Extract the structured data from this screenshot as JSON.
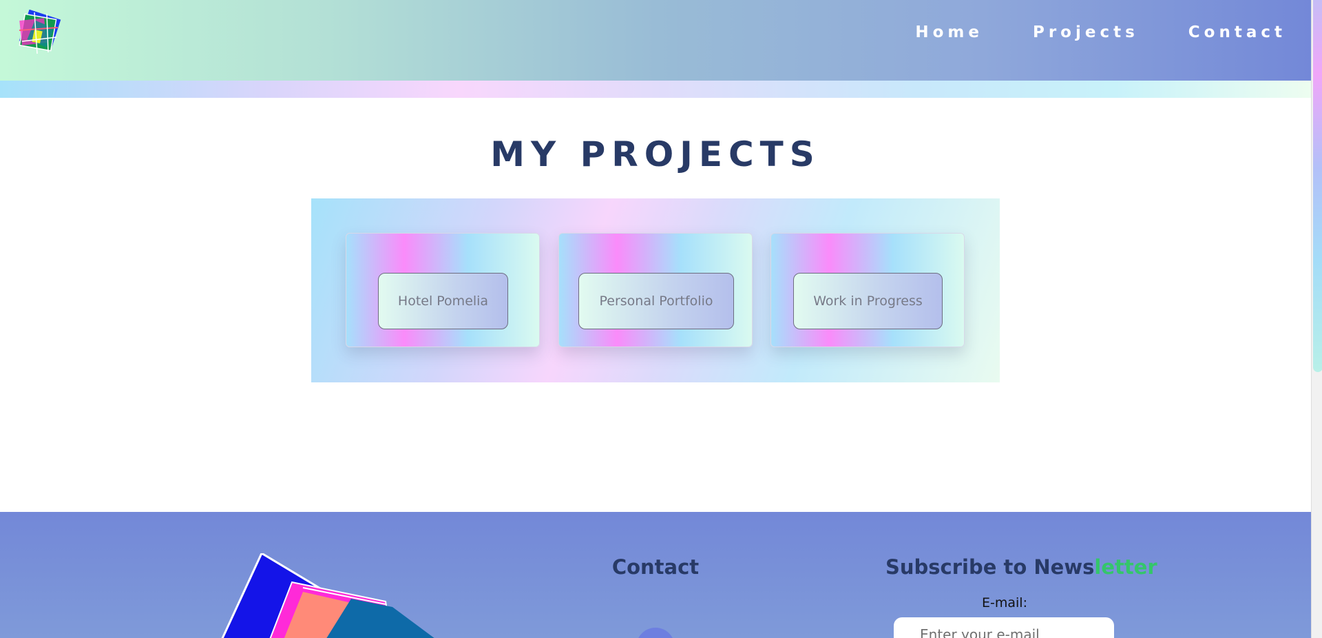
{
  "nav": {
    "items": [
      {
        "label": "Home"
      },
      {
        "label": "Projects"
      },
      {
        "label": "Contact"
      }
    ]
  },
  "main": {
    "title": "MY PROJECTS",
    "projects": [
      {
        "label": "Hotel Pomelia"
      },
      {
        "label": "Personal Portfolio"
      },
      {
        "label": "Work in Progress"
      }
    ]
  },
  "footer": {
    "contact_title": "Contact",
    "newsletter_title_main": "Subscribe to News",
    "newsletter_title_accent": "letter",
    "email_label": "E-mail:",
    "email_placeholder": "Enter your e-mail"
  },
  "colors": {
    "heading": "#283a66",
    "footer_bg": "#7388d8",
    "accent_green": "#34c66a"
  },
  "icons": [
    "logo-icon",
    "contact-icon"
  ]
}
